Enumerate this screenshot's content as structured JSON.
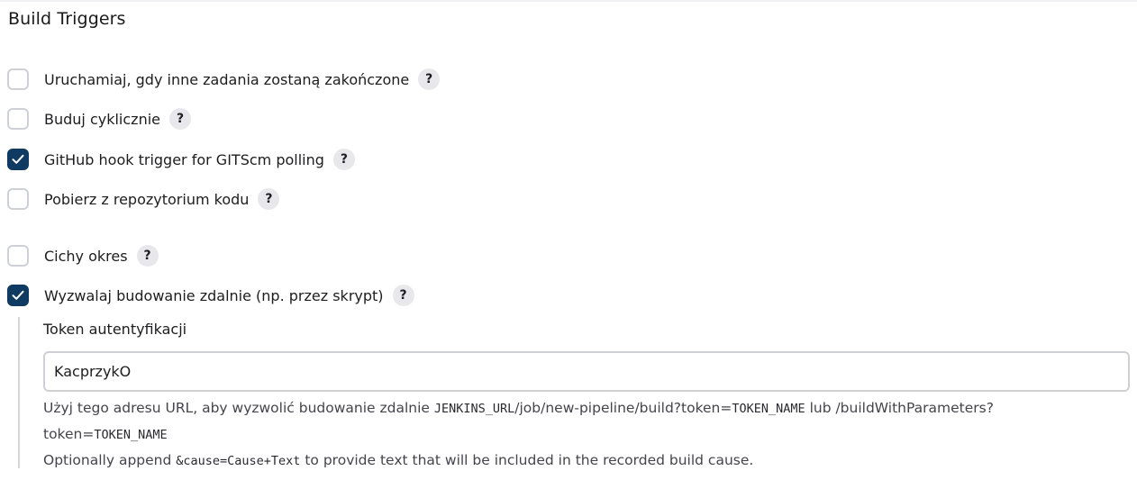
{
  "section": {
    "title": "Build Triggers"
  },
  "triggers": [
    {
      "label": "Uruchamiaj, gdy inne zadania zostaną zakończone",
      "checked": false
    },
    {
      "label": "Buduj cyklicznie",
      "checked": false
    },
    {
      "label": "GitHub hook trigger for GITScm polling",
      "checked": true
    },
    {
      "label": "Pobierz z repozytorium kodu",
      "checked": false
    },
    {
      "label": "Cichy okres",
      "checked": false
    },
    {
      "label": "Wyzwalaj budowanie zdalnie (np. przez skrypt)",
      "checked": true
    }
  ],
  "help_glyph": "?",
  "remote_trigger": {
    "token_label": "Token autentyfikacji",
    "token_value": "KacprzykO",
    "help_line1_prefix": "Użyj tego adresu URL, aby wyzwolić budowanie zdalnie ",
    "help_line1_code1": "JENKINS_URL",
    "help_line1_mid": "/job/new-pipeline/build?token=",
    "help_line1_code2": "TOKEN_NAME",
    "help_line1_suffix": " lub /buildWithParameters?",
    "help_line2_prefix": "token=",
    "help_line2_code": "TOKEN_NAME",
    "help_line3_prefix": "Optionally append ",
    "help_line3_code": "&cause=Cause+Text",
    "help_line3_suffix": " to provide text that will be included in the recorded build cause."
  },
  "colors": {
    "checkbox_checked": "#0f3a62",
    "checkbox_border": "#cfd0d6",
    "help_bubble": "#e8e8ec"
  },
  "icons": {
    "checked": "checkmark-icon",
    "help": "question-mark-icon"
  }
}
